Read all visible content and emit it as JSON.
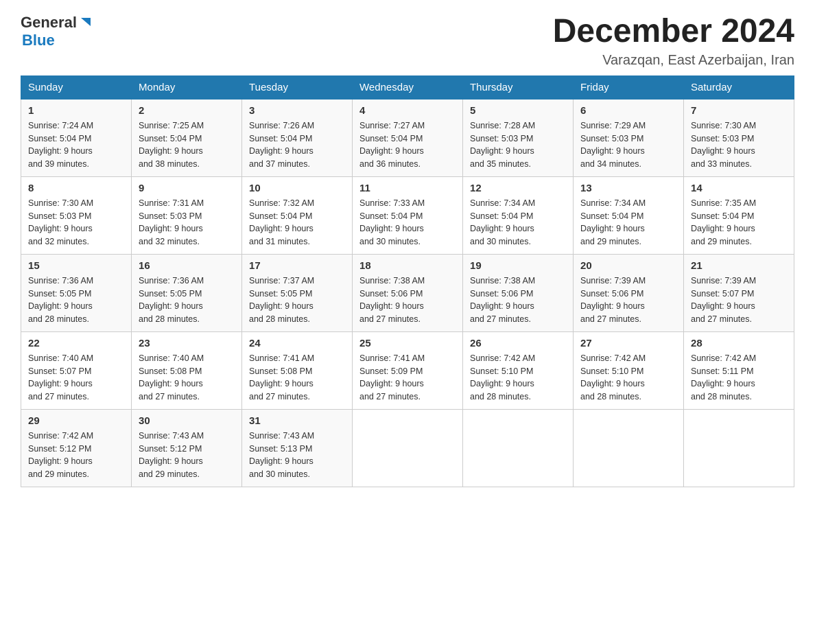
{
  "header": {
    "logo": {
      "general": "General",
      "arrow": "▲",
      "blue": "Blue"
    },
    "title": "December 2024",
    "location": "Varazqan, East Azerbaijan, Iran"
  },
  "days_of_week": [
    "Sunday",
    "Monday",
    "Tuesday",
    "Wednesday",
    "Thursday",
    "Friday",
    "Saturday"
  ],
  "weeks": [
    [
      {
        "day": "1",
        "sunrise": "7:24 AM",
        "sunset": "5:04 PM",
        "daylight": "9 hours and 39 minutes."
      },
      {
        "day": "2",
        "sunrise": "7:25 AM",
        "sunset": "5:04 PM",
        "daylight": "9 hours and 38 minutes."
      },
      {
        "day": "3",
        "sunrise": "7:26 AM",
        "sunset": "5:04 PM",
        "daylight": "9 hours and 37 minutes."
      },
      {
        "day": "4",
        "sunrise": "7:27 AM",
        "sunset": "5:04 PM",
        "daylight": "9 hours and 36 minutes."
      },
      {
        "day": "5",
        "sunrise": "7:28 AM",
        "sunset": "5:03 PM",
        "daylight": "9 hours and 35 minutes."
      },
      {
        "day": "6",
        "sunrise": "7:29 AM",
        "sunset": "5:03 PM",
        "daylight": "9 hours and 34 minutes."
      },
      {
        "day": "7",
        "sunrise": "7:30 AM",
        "sunset": "5:03 PM",
        "daylight": "9 hours and 33 minutes."
      }
    ],
    [
      {
        "day": "8",
        "sunrise": "7:30 AM",
        "sunset": "5:03 PM",
        "daylight": "9 hours and 32 minutes."
      },
      {
        "day": "9",
        "sunrise": "7:31 AM",
        "sunset": "5:03 PM",
        "daylight": "9 hours and 32 minutes."
      },
      {
        "day": "10",
        "sunrise": "7:32 AM",
        "sunset": "5:04 PM",
        "daylight": "9 hours and 31 minutes."
      },
      {
        "day": "11",
        "sunrise": "7:33 AM",
        "sunset": "5:04 PM",
        "daylight": "9 hours and 30 minutes."
      },
      {
        "day": "12",
        "sunrise": "7:34 AM",
        "sunset": "5:04 PM",
        "daylight": "9 hours and 30 minutes."
      },
      {
        "day": "13",
        "sunrise": "7:34 AM",
        "sunset": "5:04 PM",
        "daylight": "9 hours and 29 minutes."
      },
      {
        "day": "14",
        "sunrise": "7:35 AM",
        "sunset": "5:04 PM",
        "daylight": "9 hours and 29 minutes."
      }
    ],
    [
      {
        "day": "15",
        "sunrise": "7:36 AM",
        "sunset": "5:05 PM",
        "daylight": "9 hours and 28 minutes."
      },
      {
        "day": "16",
        "sunrise": "7:36 AM",
        "sunset": "5:05 PM",
        "daylight": "9 hours and 28 minutes."
      },
      {
        "day": "17",
        "sunrise": "7:37 AM",
        "sunset": "5:05 PM",
        "daylight": "9 hours and 28 minutes."
      },
      {
        "day": "18",
        "sunrise": "7:38 AM",
        "sunset": "5:06 PM",
        "daylight": "9 hours and 27 minutes."
      },
      {
        "day": "19",
        "sunrise": "7:38 AM",
        "sunset": "5:06 PM",
        "daylight": "9 hours and 27 minutes."
      },
      {
        "day": "20",
        "sunrise": "7:39 AM",
        "sunset": "5:06 PM",
        "daylight": "9 hours and 27 minutes."
      },
      {
        "day": "21",
        "sunrise": "7:39 AM",
        "sunset": "5:07 PM",
        "daylight": "9 hours and 27 minutes."
      }
    ],
    [
      {
        "day": "22",
        "sunrise": "7:40 AM",
        "sunset": "5:07 PM",
        "daylight": "9 hours and 27 minutes."
      },
      {
        "day": "23",
        "sunrise": "7:40 AM",
        "sunset": "5:08 PM",
        "daylight": "9 hours and 27 minutes."
      },
      {
        "day": "24",
        "sunrise": "7:41 AM",
        "sunset": "5:08 PM",
        "daylight": "9 hours and 27 minutes."
      },
      {
        "day": "25",
        "sunrise": "7:41 AM",
        "sunset": "5:09 PM",
        "daylight": "9 hours and 27 minutes."
      },
      {
        "day": "26",
        "sunrise": "7:42 AM",
        "sunset": "5:10 PM",
        "daylight": "9 hours and 28 minutes."
      },
      {
        "day": "27",
        "sunrise": "7:42 AM",
        "sunset": "5:10 PM",
        "daylight": "9 hours and 28 minutes."
      },
      {
        "day": "28",
        "sunrise": "7:42 AM",
        "sunset": "5:11 PM",
        "daylight": "9 hours and 28 minutes."
      }
    ],
    [
      {
        "day": "29",
        "sunrise": "7:42 AM",
        "sunset": "5:12 PM",
        "daylight": "9 hours and 29 minutes."
      },
      {
        "day": "30",
        "sunrise": "7:43 AM",
        "sunset": "5:12 PM",
        "daylight": "9 hours and 29 minutes."
      },
      {
        "day": "31",
        "sunrise": "7:43 AM",
        "sunset": "5:13 PM",
        "daylight": "9 hours and 30 minutes."
      },
      null,
      null,
      null,
      null
    ]
  ],
  "labels": {
    "sunrise": "Sunrise:",
    "sunset": "Sunset:",
    "daylight": "Daylight:"
  }
}
